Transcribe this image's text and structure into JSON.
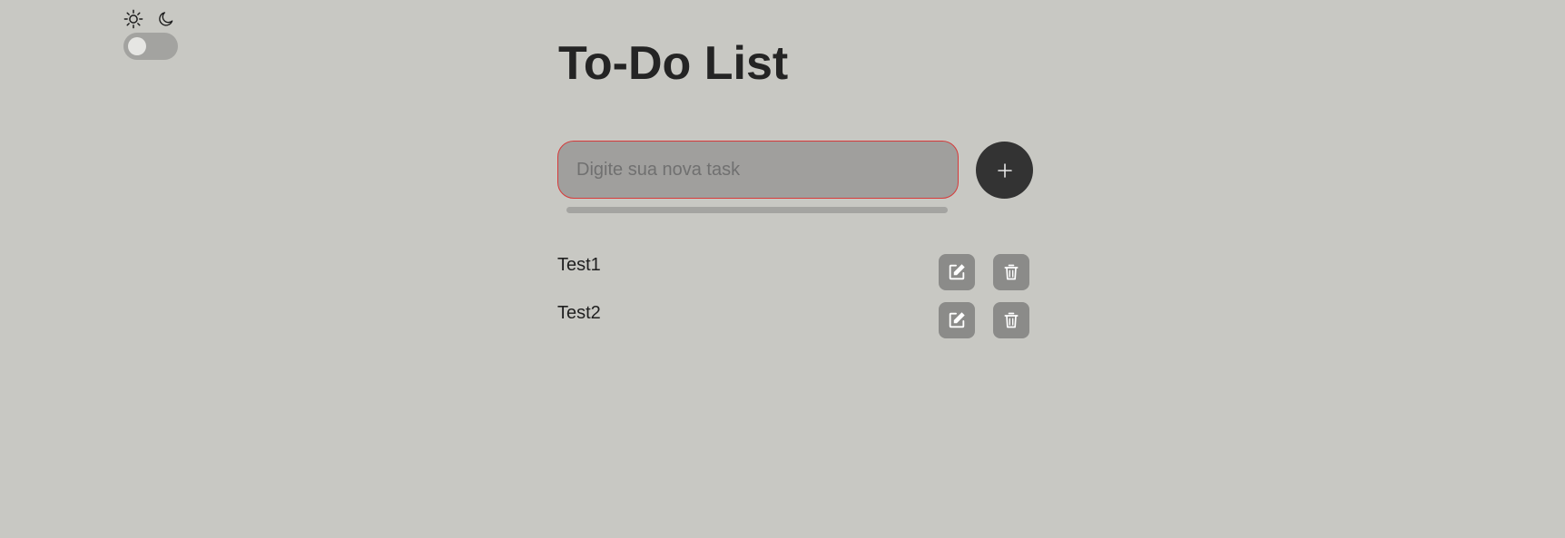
{
  "theme_switch": {
    "light_icon": "sun-icon",
    "dark_icon": "moon-icon",
    "state": "light"
  },
  "header": {
    "title": "To-Do List"
  },
  "new_task": {
    "placeholder": "Digite sua nova task",
    "value": "",
    "add_icon": "plus-icon"
  },
  "tasks": [
    {
      "label": "Test1",
      "edit_icon": "edit-icon",
      "delete_icon": "trash-icon"
    },
    {
      "label": "Test2",
      "edit_icon": "edit-icon",
      "delete_icon": "trash-icon"
    }
  ],
  "colors": {
    "background": "#c8c8c3",
    "input_border": "#d63a3a",
    "input_background": "#a09f9d",
    "add_button": "#333333",
    "icon_button": "#8b8b89"
  }
}
